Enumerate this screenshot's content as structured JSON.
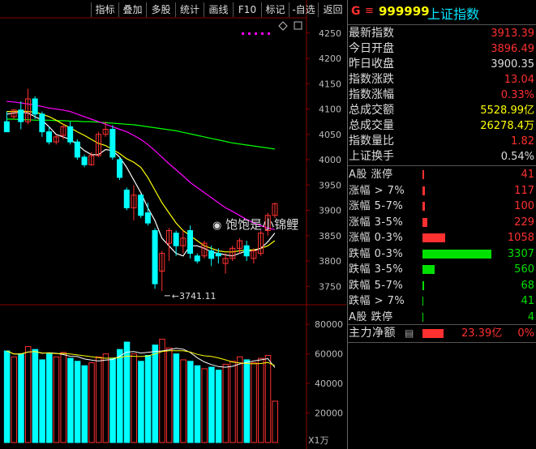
{
  "toolbar": {
    "buttons": [
      "指标",
      "叠加",
      "多股",
      "统计",
      "画线",
      "F10",
      "标记",
      "-自选",
      "返回"
    ]
  },
  "chart": {
    "price_ticks": [
      "4250",
      "4200",
      "4150",
      "4100",
      "4050",
      "4000",
      "3950",
      "3900",
      "3850",
      "3800",
      "3750"
    ],
    "volume_ticks": [
      "80000",
      "60000",
      "40000",
      "20000"
    ],
    "volume_unit": "X1万",
    "low_marker": "3741.11",
    "watermark": "饱饱是小锦鲤",
    "colors": {
      "up": "#ff3030",
      "down": "#00ffff",
      "ma5": "#ffffff",
      "ma10": "#ffff00",
      "ma20": "#ff00ff",
      "ma60": "#00ff00"
    }
  },
  "chart_data": {
    "type": "candlestick",
    "ylim": [
      3720,
      4280
    ],
    "candles": [
      [
        4075,
        4095,
        4065,
        4055
      ],
      [
        4085,
        4100,
        4080,
        4098
      ],
      [
        4098,
        4115,
        4060,
        4075
      ],
      [
        4075,
        4140,
        4070,
        4120
      ],
      [
        4120,
        4125,
        4080,
        4090
      ],
      [
        4090,
        4095,
        4045,
        4055
      ],
      [
        4055,
        4065,
        4030,
        4035
      ],
      [
        4035,
        4050,
        4030,
        4045
      ],
      [
        4048,
        4070,
        4040,
        4065
      ],
      [
        4065,
        4075,
        4030,
        4035
      ],
      [
        4035,
        4040,
        4000,
        4005
      ],
      [
        4005,
        4010,
        3985,
        3990
      ],
      [
        3990,
        4015,
        3988,
        4008
      ],
      [
        4008,
        4055,
        4005,
        4050
      ],
      [
        4050,
        4075,
        4045,
        4060
      ],
      [
        4060,
        4068,
        4000,
        4005
      ],
      [
        4000,
        4005,
        3960,
        3965
      ],
      [
        3940,
        3945,
        3900,
        3905
      ],
      [
        3905,
        3950,
        3880,
        3930
      ],
      [
        3930,
        3932,
        3885,
        3890
      ],
      [
        3895,
        3915,
        3870,
        3875
      ],
      [
        3860,
        3865,
        3745,
        3755
      ],
      [
        3780,
        3820,
        3741,
        3815
      ],
      [
        3835,
        3865,
        3800,
        3860
      ],
      [
        3855,
        3860,
        3810,
        3830
      ],
      [
        3830,
        3860,
        3815,
        3845
      ],
      [
        3860,
        3870,
        3805,
        3815
      ],
      [
        3810,
        3815,
        3795,
        3800
      ],
      [
        3810,
        3840,
        3805,
        3835
      ],
      [
        3820,
        3830,
        3790,
        3805
      ],
      [
        3815,
        3825,
        3795,
        3810
      ],
      [
        3795,
        3815,
        3775,
        3805
      ],
      [
        3805,
        3830,
        3800,
        3825
      ],
      [
        3825,
        3845,
        3815,
        3840
      ],
      [
        3830,
        3840,
        3800,
        3810
      ],
      [
        3805,
        3825,
        3795,
        3820
      ],
      [
        3815,
        3860,
        3810,
        3855
      ],
      [
        3860,
        3895,
        3850,
        3890
      ],
      [
        3890,
        3915,
        3885,
        3913
      ]
    ],
    "volume": [
      62000,
      58000,
      60000,
      65000,
      63000,
      56000,
      60000,
      58000,
      61000,
      57000,
      55000,
      52000,
      54000,
      58000,
      60000,
      57000,
      63000,
      68000,
      60000,
      55000,
      59000,
      66000,
      70000,
      64000,
      60000,
      56000,
      55000,
      52000,
      50000,
      51000,
      49000,
      53000,
      55000,
      58000,
      56000,
      54000,
      57000,
      59000,
      28000
    ],
    "ma": {
      "ma5": [
        4090,
        4092,
        4094,
        4092,
        4085,
        4078,
        4065,
        4050,
        4045,
        4040,
        4030,
        4018,
        4010,
        4010,
        4020,
        4018,
        4005,
        3985,
        3960,
        3935,
        3905,
        3880,
        3845,
        3830,
        3815,
        3810,
        3830,
        3830,
        3825,
        3818,
        3815,
        3812,
        3810,
        3815,
        3820,
        3820,
        3825,
        3838,
        3855
      ],
      "ma10": [
        4095,
        4095,
        4096,
        4095,
        4094,
        4090,
        4085,
        4078,
        4070,
        4063,
        4055,
        4048,
        4040,
        4032,
        4028,
        4020,
        4012,
        4002,
        3995,
        3985,
        3965,
        3940,
        3915,
        3895,
        3875,
        3860,
        3850,
        3840,
        3830,
        3825,
        3820,
        3818,
        3818,
        3820,
        3822,
        3822,
        3825,
        3830,
        3840
      ],
      "ma20": [
        4115,
        4114,
        4112,
        4110,
        4108,
        4105,
        4102,
        4100,
        4098,
        4095,
        4090,
        4085,
        4080,
        4075,
        4070,
        4065,
        4060,
        4055,
        4048,
        4040,
        4030,
        4018,
        4005,
        3992,
        3980,
        3968,
        3955,
        3945,
        3935,
        3925,
        3915,
        3905,
        3898,
        3890,
        3882,
        3875,
        3870,
        3865,
        3862
      ],
      "ma60": [
        4080,
        4080,
        4079,
        4079,
        4078,
        4078,
        4078,
        4077,
        4077,
        4076,
        4076,
        4075,
        4075,
        4074,
        4073,
        4072,
        4071,
        4070,
        4069,
        4067,
        4065,
        4063,
        4061,
        4059,
        4057,
        4054,
        4051,
        4048,
        4045,
        4042,
        4039,
        4036,
        4033,
        4031,
        4029,
        4027,
        4025,
        4023,
        4021
      ]
    }
  },
  "panel": {
    "g": "G",
    "menu_icon": "≡",
    "code": "999999",
    "name": "上证指数",
    "stats": [
      {
        "label": "最新指数",
        "value": "3913.39",
        "color": "#ff3030"
      },
      {
        "label": "今日开盘",
        "value": "3896.49",
        "color": "#ff3030"
      },
      {
        "label": "昨日收盘",
        "value": "3900.35",
        "color": "#ddd"
      },
      {
        "label": "指数涨跌",
        "value": "13.04",
        "color": "#ff3030"
      },
      {
        "label": "指数涨幅",
        "value": "0.33%",
        "color": "#ff3030"
      },
      {
        "label": "总成交额",
        "value": "5528.99亿",
        "color": "#ffff00"
      },
      {
        "label": "总成交量",
        "value": "26278.4万",
        "color": "#ffff00"
      },
      {
        "label": "指数量比",
        "value": "1.82",
        "color": "#ff3030"
      },
      {
        "label": "上证换手",
        "value": "0.54%",
        "color": "#ddd"
      }
    ],
    "breadth": [
      {
        "label": "A股 涨停",
        "value": "41",
        "color": "#ff3030",
        "bar": 2
      },
      {
        "label": "涨幅 > 7%",
        "value": "117",
        "color": "#ff3030",
        "bar": 3
      },
      {
        "label": "涨幅 5-7%",
        "value": "100",
        "color": "#ff3030",
        "bar": 3
      },
      {
        "label": "涨幅 3-5%",
        "value": "229",
        "color": "#ff3030",
        "bar": 6
      },
      {
        "label": "涨幅 0-3%",
        "value": "1058",
        "color": "#ff3030",
        "bar": 28
      },
      {
        "label": "跌幅 0-3%",
        "value": "3307",
        "color": "#00e000",
        "bar": 85
      },
      {
        "label": "跌幅 3-5%",
        "value": "560",
        "color": "#00e000",
        "bar": 15
      },
      {
        "label": "跌幅 5-7%",
        "value": "68",
        "color": "#00e000",
        "bar": 2
      },
      {
        "label": "跌幅 > 7%",
        "value": "41",
        "color": "#00e000",
        "bar": 1
      },
      {
        "label": "A股 跌停",
        "value": "4",
        "color": "#00e000",
        "bar": 1
      }
    ],
    "mainflow": {
      "label": "主力净额",
      "value": "23.39亿",
      "pct": "0%",
      "color": "#ff3030"
    }
  }
}
